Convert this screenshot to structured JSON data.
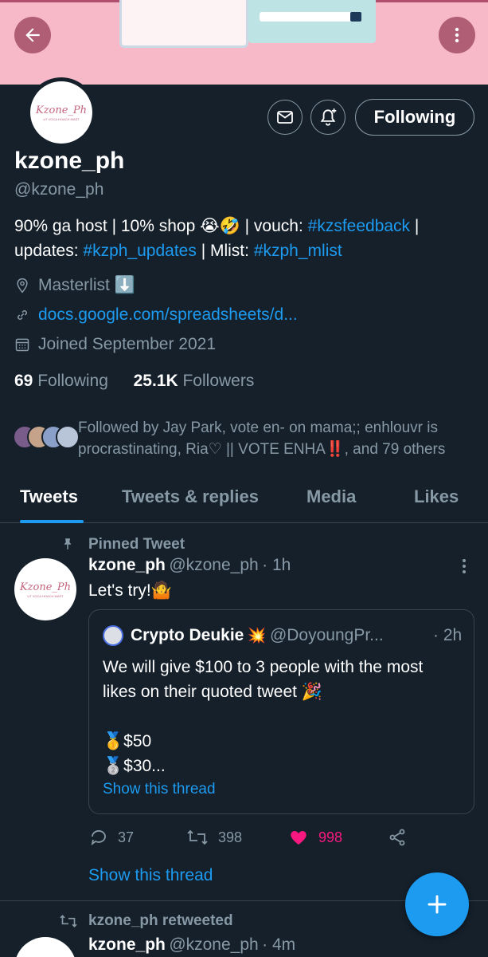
{
  "profile": {
    "name": "kzone_ph",
    "handle": "@kzone_ph",
    "avatar_text": "Kzone_Ph",
    "avatar_sub": "UT VOCA HOACH MAST",
    "follow_button": "Following",
    "bio_part1": "90% ga host | 10% shop 😭🤣 | vouch: ",
    "bio_tag1": "#kzsfeedback",
    "bio_part2": " | updates: ",
    "bio_tag2": "#kzph_updates",
    "bio_part3": " |  Mlist: ",
    "bio_tag3": "#kzph_mlist",
    "location": "Masterlist ⬇️",
    "website": "docs.google.com/spreadsheets/d...",
    "joined": "Joined September 2021",
    "following_count": "69",
    "following_label": " Following",
    "followers_count": "25.1K",
    "followers_label": " Followers",
    "followed_by_1": "Followed by Jay Park, vote en- on mama;; enhlouvr is",
    "followed_by_2": "procrastinating, Ria♡ || VOTE ENHA",
    "followed_by_emoji": "‼️",
    "followed_by_3": ", and 79 others"
  },
  "tabs": [
    "Tweets",
    "Tweets & replies",
    "Media",
    "Likes"
  ],
  "pinned_tweet": {
    "pinned_label": "Pinned Tweet",
    "author": "kzone_ph",
    "handle": "@kzone_ph",
    "time": "· 1h",
    "text": "Let's try!🤷",
    "quote": {
      "author": "Crypto Deukie",
      "verified_emoji": "💥",
      "handle": "@DoyoungPr...",
      "time": "· 2h",
      "line1": "We will give $100 to 3 people with the most",
      "line2": "likes on their quoted tweet 🎉",
      "line3": "🥇$50",
      "line4": "🥈$30...",
      "show_thread": "Show this thread"
    },
    "replies": "37",
    "retweets": "398",
    "likes": "998",
    "show_thread": "Show this thread"
  },
  "next_tweet": {
    "retweeted_label": "kzone_ph retweeted",
    "author": "kzone_ph",
    "handle": "@kzone_ph",
    "time": "· 4m"
  },
  "colors": {
    "background": "#15202b",
    "accent": "#1d9bf0",
    "like": "#f91880",
    "banner": "#f7b9c8"
  }
}
